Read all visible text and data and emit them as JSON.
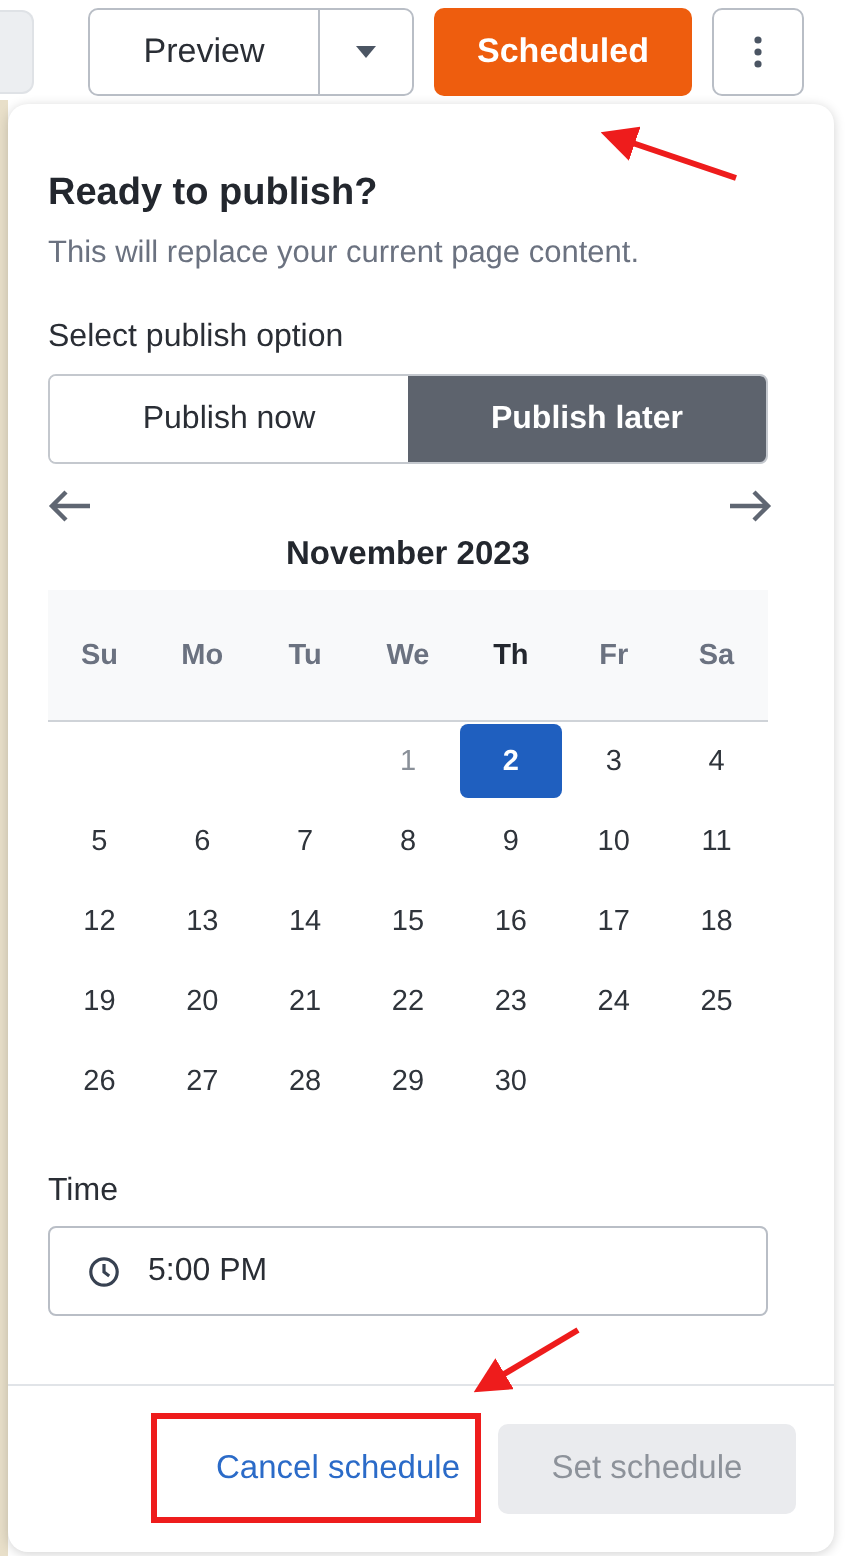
{
  "toolbar": {
    "preview_button": "Preview",
    "status_button": "Scheduled"
  },
  "dialog": {
    "title": "Ready to publish?",
    "subtitle": "This will replace your current page content.",
    "option_label": "Select publish option",
    "options": [
      {
        "label": "Publish now",
        "selected": false
      },
      {
        "label": "Publish later",
        "selected": true
      }
    ],
    "calendar": {
      "month_title": "November 2023",
      "weekdays": [
        {
          "label": "Su",
          "current": false
        },
        {
          "label": "Mo",
          "current": false
        },
        {
          "label": "Tu",
          "current": false
        },
        {
          "label": "We",
          "current": false
        },
        {
          "label": "Th",
          "current": true
        },
        {
          "label": "Fr",
          "current": false
        },
        {
          "label": "Sa",
          "current": false
        }
      ],
      "weeks": [
        [
          {
            "kind": "blank"
          },
          {
            "kind": "blank"
          },
          {
            "kind": "blank"
          },
          {
            "label": "1",
            "selected": false,
            "disabled": true
          },
          {
            "label": "2",
            "selected": true,
            "disabled": false
          },
          {
            "label": "3",
            "selected": false,
            "disabled": false
          },
          {
            "label": "4",
            "selected": false,
            "disabled": false
          }
        ],
        [
          {
            "label": "5",
            "selected": false,
            "disabled": false
          },
          {
            "label": "6",
            "selected": false,
            "disabled": false
          },
          {
            "label": "7",
            "selected": false,
            "disabled": false
          },
          {
            "label": "8",
            "selected": false,
            "disabled": false
          },
          {
            "label": "9",
            "selected": false,
            "disabled": false
          },
          {
            "label": "10",
            "selected": false,
            "disabled": false
          },
          {
            "label": "11",
            "selected": false,
            "disabled": false
          }
        ],
        [
          {
            "label": "12",
            "selected": false,
            "disabled": false
          },
          {
            "label": "13",
            "selected": false,
            "disabled": false
          },
          {
            "label": "14",
            "selected": false,
            "disabled": false
          },
          {
            "label": "15",
            "selected": false,
            "disabled": false
          },
          {
            "label": "16",
            "selected": false,
            "disabled": false
          },
          {
            "label": "17",
            "selected": false,
            "disabled": false
          },
          {
            "label": "18",
            "selected": false,
            "disabled": false
          }
        ],
        [
          {
            "label": "19",
            "selected": false,
            "disabled": false
          },
          {
            "label": "20",
            "selected": false,
            "disabled": false
          },
          {
            "label": "21",
            "selected": false,
            "disabled": false
          },
          {
            "label": "22",
            "selected": false,
            "disabled": false
          },
          {
            "label": "23",
            "selected": false,
            "disabled": false
          },
          {
            "label": "24",
            "selected": false,
            "disabled": false
          },
          {
            "label": "25",
            "selected": false,
            "disabled": false
          }
        ],
        [
          {
            "label": "26",
            "selected": false,
            "disabled": false
          },
          {
            "label": "27",
            "selected": false,
            "disabled": false
          },
          {
            "label": "28",
            "selected": false,
            "disabled": false
          },
          {
            "label": "29",
            "selected": false,
            "disabled": false
          },
          {
            "label": "30",
            "selected": false,
            "disabled": false
          },
          {
            "kind": "blank"
          },
          {
            "kind": "blank"
          }
        ]
      ]
    },
    "time": {
      "label": "Time",
      "value": "5:00 PM"
    },
    "actions": [
      {
        "label": "Cancel schedule",
        "kind": "link",
        "disabled": false
      },
      {
        "label": "Set schedule",
        "kind": "button",
        "disabled": true
      }
    ]
  }
}
